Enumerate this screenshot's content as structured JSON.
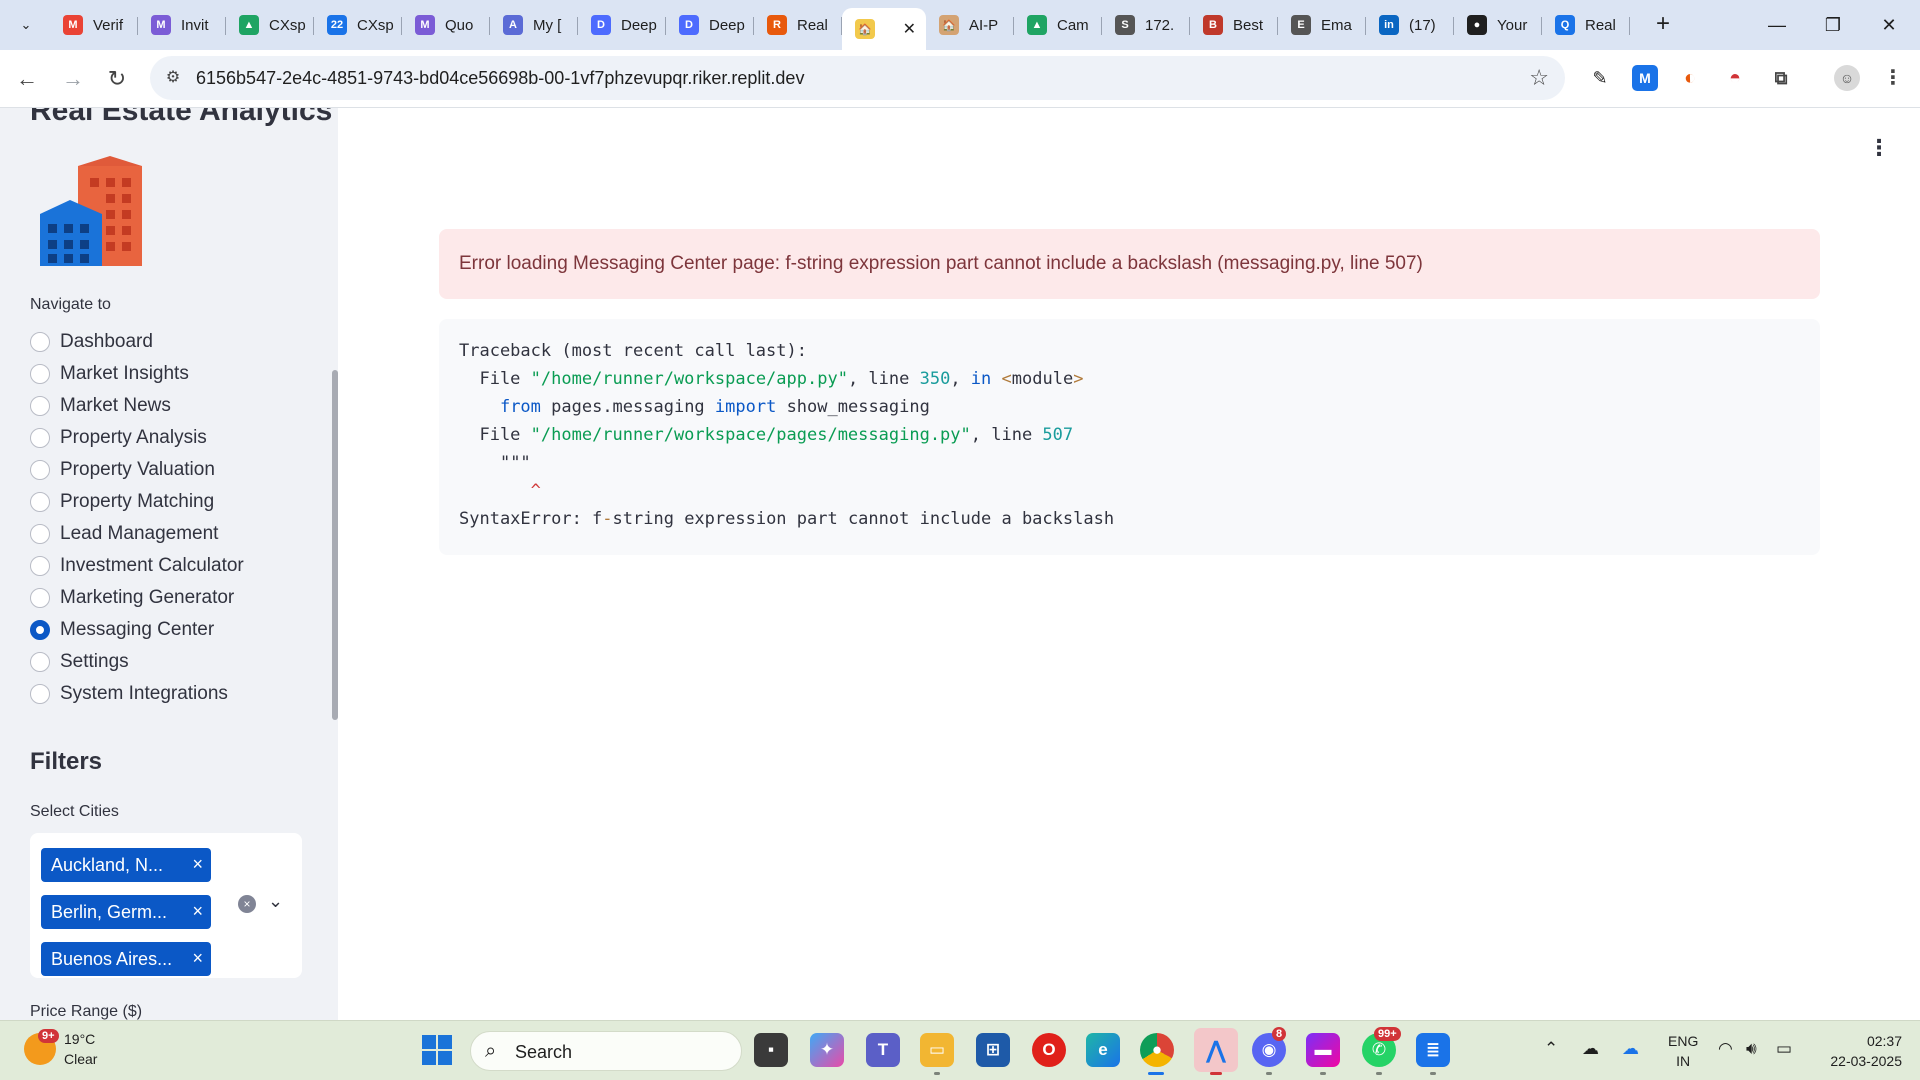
{
  "browser": {
    "tabs": [
      {
        "label": "Verif",
        "fav": "M",
        "favColor": "#ea4335"
      },
      {
        "label": "Invit",
        "fav": "M",
        "favColor": "#7b5cd6"
      },
      {
        "label": "CXsp",
        "fav": "▲",
        "favColor": "#1fa463"
      },
      {
        "label": "CXsp",
        "fav": "22",
        "favColor": "#1a73e8"
      },
      {
        "label": "Quo",
        "fav": "M",
        "favColor": "#7b5cd6"
      },
      {
        "label": "My [",
        "fav": "A",
        "favColor": "#5b6bd6"
      },
      {
        "label": "Deep",
        "fav": "D",
        "favColor": "#4d6bfe"
      },
      {
        "label": "Deep",
        "fav": "D",
        "favColor": "#4d6bfe"
      },
      {
        "label": "Real",
        "fav": "R",
        "favColor": "#e8590c"
      },
      {
        "label": "",
        "fav": "🏠",
        "favColor": "#f2c94c"
      },
      {
        "label": "AI-P",
        "fav": "🏠",
        "favColor": "#d4a373"
      },
      {
        "label": "Cam",
        "fav": "▲",
        "favColor": "#1fa463"
      },
      {
        "label": "172.",
        "fav": "S",
        "favColor": "#555"
      },
      {
        "label": "Best",
        "fav": "B",
        "favColor": "#c0392b"
      },
      {
        "label": "Ema",
        "fav": "E",
        "favColor": "#555"
      },
      {
        "label": "(17)",
        "fav": "in",
        "favColor": "#0a66c2"
      },
      {
        "label": "Your",
        "fav": "●",
        "favColor": "#1f1f1f"
      },
      {
        "label": "Real",
        "fav": "Q",
        "favColor": "#1a73e8"
      }
    ],
    "active_tab_close": "✕",
    "url": "6156b547-2e4c-4851-9743-bd04ce56698b-00-1vf7phzevupqr.riker.replit.dev"
  },
  "sidebar": {
    "title": "Real Estate Analytics",
    "nav_label": "Navigate to",
    "nav_items": [
      {
        "label": "Dashboard",
        "selected": false
      },
      {
        "label": "Market Insights",
        "selected": false
      },
      {
        "label": "Market News",
        "selected": false
      },
      {
        "label": "Property Analysis",
        "selected": false
      },
      {
        "label": "Property Valuation",
        "selected": false
      },
      {
        "label": "Property Matching",
        "selected": false
      },
      {
        "label": "Lead Management",
        "selected": false
      },
      {
        "label": "Investment Calculator",
        "selected": false
      },
      {
        "label": "Marketing Generator",
        "selected": false
      },
      {
        "label": "Messaging Center",
        "selected": true
      },
      {
        "label": "Settings",
        "selected": false
      },
      {
        "label": "System Integrations",
        "selected": false
      }
    ],
    "filters_heading": "Filters",
    "cities_label": "Select Cities",
    "selected_cities": [
      "Auckland, N...",
      "Berlin, Germ...",
      "Buenos Aires..."
    ],
    "price_label": "Price Range ($)"
  },
  "main": {
    "error_message": "Error loading Messaging Center page: f-string expression part cannot include a backslash (messaging.py, line 507)",
    "traceback": {
      "l1": "Traceback (most recent call last):",
      "l2_pre": "  File ",
      "l2_path": "\"/home/runner/workspace/app.py\"",
      "l2_mid": ", line ",
      "l2_num": "350",
      "l2_in": "in",
      "l2_mod": "<module>",
      "l3_from": "from",
      "l3_mid": " pages.messaging ",
      "l3_import": "import",
      "l3_end": " show_messaging",
      "l4_path": "\"/home/runner/workspace/pages/messaging.py\"",
      "l4_num": "507",
      "l5": "\"\"\"",
      "l6": "^",
      "l7_a": "SyntaxError: f",
      "l7_b": "-",
      "l7_c": "string expression part cannot include a backslash"
    }
  },
  "taskbar": {
    "weather_temp": "19°C",
    "weather_status": "Clear",
    "weather_badge": "9+",
    "search_label": "Search",
    "discord_badge": "8",
    "whatsapp_badge": "99+",
    "lang_top": "ENG",
    "lang_bottom": "IN",
    "time": "02:37",
    "date": "22-03-2025"
  }
}
